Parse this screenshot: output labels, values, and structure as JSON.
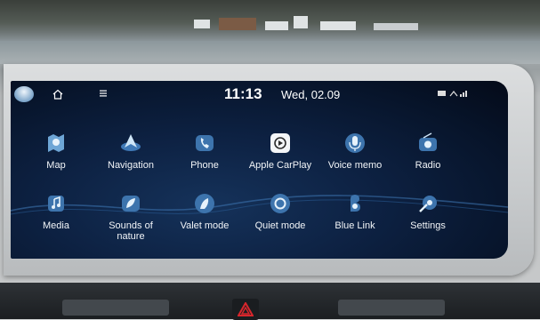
{
  "status_bar": {
    "time": "11:13",
    "date": "Wed, 02.09"
  },
  "apps": [
    {
      "label": "Map",
      "icon": "map-icon"
    },
    {
      "label": "Navigation",
      "icon": "navigation-icon"
    },
    {
      "label": "Phone",
      "icon": "phone-icon"
    },
    {
      "label": "Apple CarPlay",
      "icon": "carplay-icon"
    },
    {
      "label": "Voice memo",
      "icon": "voice-memo-icon"
    },
    {
      "label": "Radio",
      "icon": "radio-icon"
    },
    {
      "label": "Media",
      "icon": "media-icon"
    },
    {
      "label": "Sounds of\nnature",
      "icon": "sounds-of-nature-icon"
    },
    {
      "label": "Valet mode",
      "icon": "valet-mode-icon"
    },
    {
      "label": "Quiet mode",
      "icon": "quiet-mode-icon"
    },
    {
      "label": "Blue Link",
      "icon": "blue-link-icon"
    },
    {
      "label": "Settings",
      "icon": "settings-icon"
    }
  ],
  "colors": {
    "screen_bg": "#0b1c38",
    "icon_accent": "#8fc0e6",
    "text": "#f2f5f8",
    "hazard": "#d8262c"
  }
}
